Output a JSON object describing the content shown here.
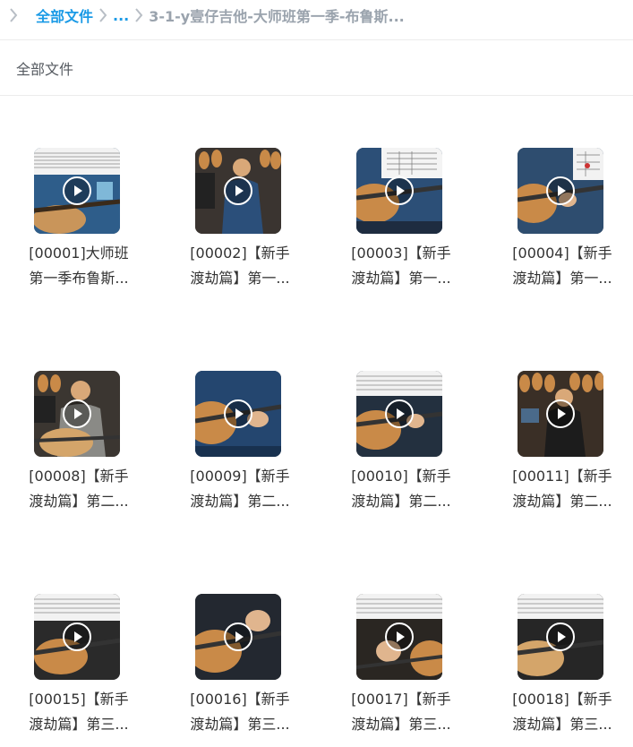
{
  "breadcrumb": {
    "root": "全部文件",
    "ellipsis": "...",
    "current": "3-1-y壹仔吉他-大师班第一季-布鲁斯..."
  },
  "subheader": {
    "title": "全部文件"
  },
  "files": [
    {
      "line1": "[00001]大师班",
      "line2": "第一季布鲁斯..."
    },
    {
      "line1": "[00002]【新手",
      "line2": "渡劫篇】第一..."
    },
    {
      "line1": "[00003]【新手",
      "line2": "渡劫篇】第一..."
    },
    {
      "line1": "[00004]【新手",
      "line2": "渡劫篇】第一..."
    },
    {
      "line1": "[00008]【新手",
      "line2": "渡劫篇】第二..."
    },
    {
      "line1": "[00009]【新手",
      "line2": "渡劫篇】第二..."
    },
    {
      "line1": "[00010]【新手",
      "line2": "渡劫篇】第二..."
    },
    {
      "line1": "[00011]【新手",
      "line2": "渡劫篇】第二..."
    },
    {
      "line1": "[00015]【新手",
      "line2": "渡劫篇】第三..."
    },
    {
      "line1": "[00016]【新手",
      "line2": "渡劫篇】第三..."
    },
    {
      "line1": "[00017]【新手",
      "line2": "渡劫篇】第三..."
    },
    {
      "line1": "[00018]【新手",
      "line2": "渡劫篇】第三..."
    }
  ],
  "icons": {
    "back": "chevron-left-icon",
    "separator": "chevron-right-icon",
    "play": "play-icon"
  },
  "colors": {
    "link": "#1a9ae6",
    "muted": "#9aa3ad",
    "text": "#333333"
  }
}
